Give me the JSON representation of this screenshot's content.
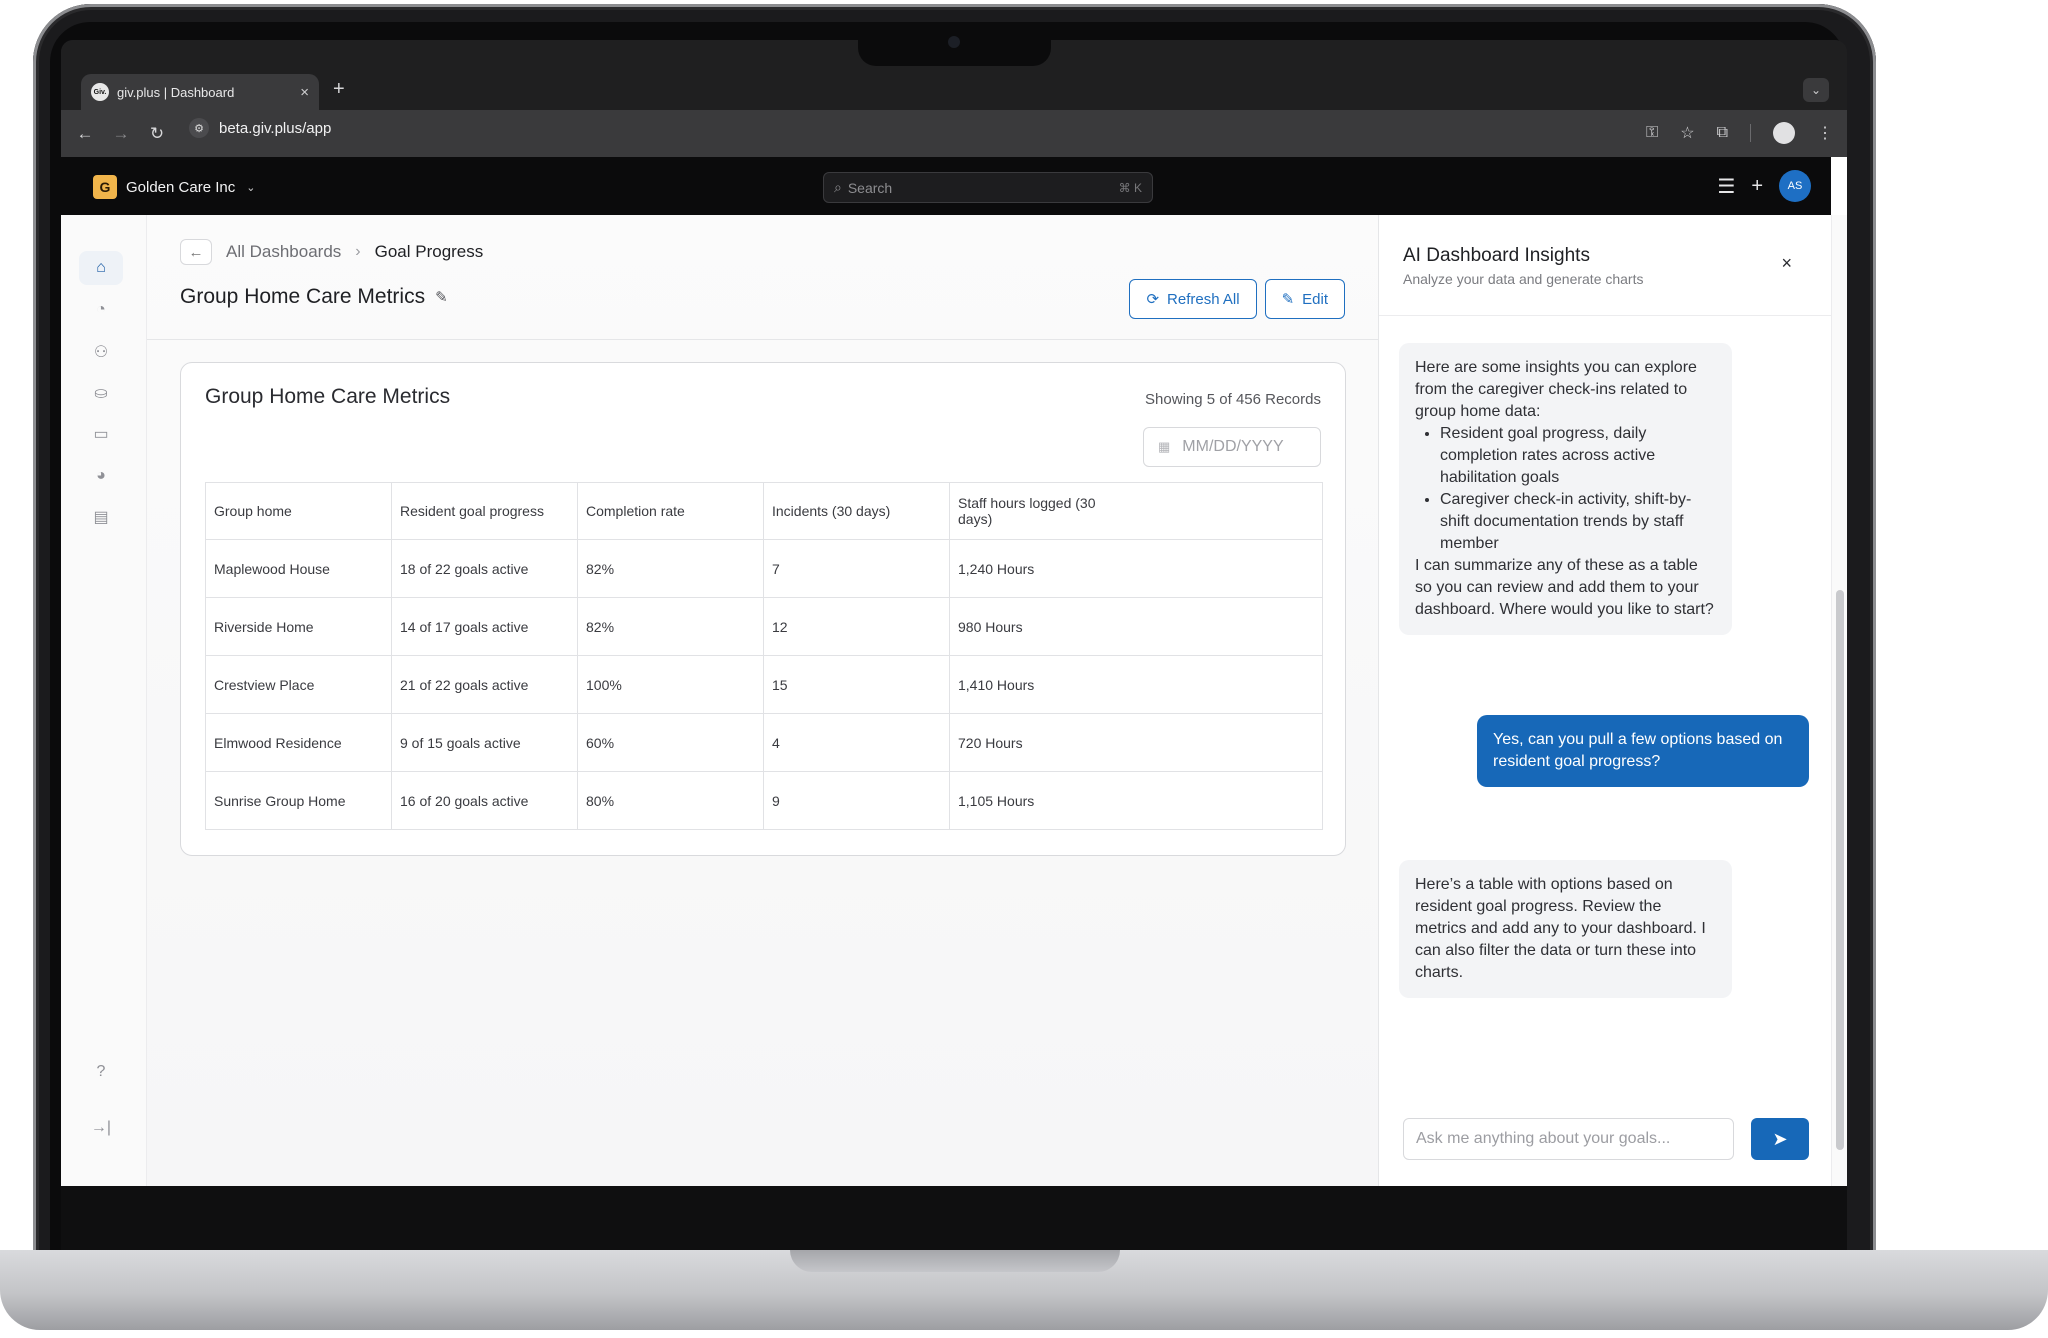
{
  "browser": {
    "tab_title": "giv.plus | Dashboard",
    "tab_favicon": "Giv.",
    "new_tab": "+",
    "url": "beta.giv.plus/app"
  },
  "app_header": {
    "org_initial": "G",
    "org_name": "Golden Care Inc",
    "search_placeholder": "Search",
    "search_shortcut": "⌘ K",
    "user_initials": "AS"
  },
  "breadcrumb": {
    "parent": "All Dashboards",
    "current": "Goal Progress"
  },
  "page": {
    "title": "Group Home Care Metrics",
    "refresh_label": "Refresh All",
    "edit_label": "Edit"
  },
  "card": {
    "title": "Group Home Care Metrics",
    "records": "Showing  5 of 456 Records",
    "date_placeholder": "MM/DD/YYYY"
  },
  "table": {
    "columns": [
      "Group home",
      "Resident goal progress",
      "Completion rate",
      "Incidents (30 days)",
      "Staff hours logged (30 days)"
    ],
    "rows": [
      [
        "Maplewood House",
        "18 of 22 goals active",
        "82%",
        "7",
        "1,240 Hours"
      ],
      [
        "Riverside Home",
        "14 of 17 goals active",
        "82%",
        "12",
        "980 Hours"
      ],
      [
        "Crestview Place",
        "21 of 22 goals active",
        "100%",
        "15",
        "1,410 Hours"
      ],
      [
        "Elmwood Residence",
        "9 of 15 goals active",
        "60%",
        "4",
        "720 Hours"
      ],
      [
        "Sunrise Group Home",
        "16 of 20 goals active",
        "80%",
        "9",
        "1,105 Hours"
      ]
    ]
  },
  "insights": {
    "title": "AI Dashboard Insights",
    "subtitle": "Analyze your data and generate charts",
    "close": "×",
    "msg1_intro": "Here are some insights you can explore from the caregiver check-ins related to group home data:",
    "msg1_bullets": [
      "Resident goal progress, daily completion rates across active habilitation goals",
      "Caregiver check-in activity, shift-by-shift documentation trends by staff member"
    ],
    "msg1_outro": "I can summarize any of these as a table so you can review and add them to your dashboard. Where would you like to start?",
    "user_msg": "Yes, can you pull a few options based on resident goal progress?",
    "msg2": "Here’s a table with options based on resident goal progress. Review the metrics and add any to your dashboard. I can also filter the data or turn these into charts.",
    "input_placeholder": "Ask me anything about your goals..."
  },
  "icons": [
    "home-icon",
    "history-icon",
    "users-icon",
    "handshake-icon",
    "card-icon",
    "chart-pie-icon",
    "notes-icon",
    "help-icon",
    "collapse-icon"
  ],
  "colors": {
    "accent": "#1768b8",
    "org_logo": "#f1b54b"
  }
}
